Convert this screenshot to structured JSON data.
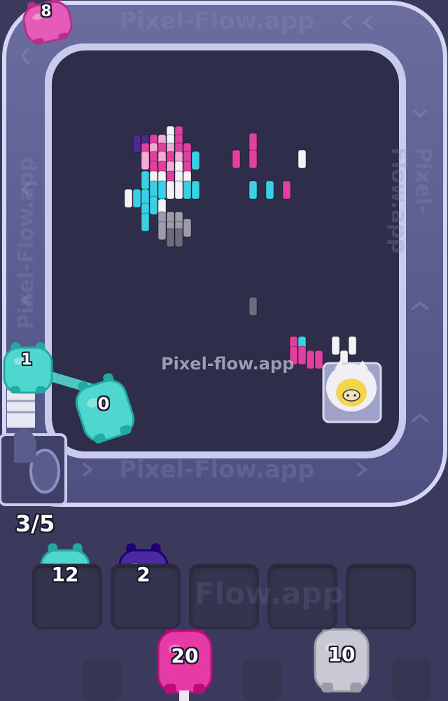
{
  "watermarks": {
    "center": "Pixel-flow.app",
    "top_belt": "Pixel-Flow.app",
    "bottom_belt": "Pixel-Flow.app",
    "right_belt": "Pixel-Flow.app",
    "left_belt": "Pixel-Flow.app",
    "slots": "Flow.app"
  },
  "conveyor_pig": {
    "count": "8",
    "color": "#e45bb8"
  },
  "shooter_pigs": [
    {
      "count": "1",
      "color": "#4fd6cf"
    },
    {
      "count": "0",
      "color": "#4fd6cf"
    }
  ],
  "belt_capacity": "3/5",
  "queue_slots": [
    {
      "count": "12",
      "color": "#4fd6cf",
      "filled": true
    },
    {
      "count": "2",
      "color": "#4b2aa0",
      "filled": true
    },
    {
      "count": "",
      "filled": false
    },
    {
      "count": "",
      "filled": false
    },
    {
      "count": "",
      "filled": false
    }
  ],
  "waiting_pigs": [
    {
      "count": "20",
      "color": "#e63aa6"
    },
    {
      "count": "10",
      "color": "#c9c9d6"
    }
  ],
  "colors": {
    "background": "#3b3a5c",
    "board": "#2f2e4a",
    "belt": "#5a5d8c",
    "belt_edge": "#c7c9ee",
    "pink": "#e0409e",
    "light_pink": "#f4a9d6",
    "white": "#f3f3f7",
    "cyan": "#3ad0e6",
    "purple": "#4a2a8c",
    "gray": "#9c9cab",
    "dark_gray": "#6c6c7c"
  }
}
